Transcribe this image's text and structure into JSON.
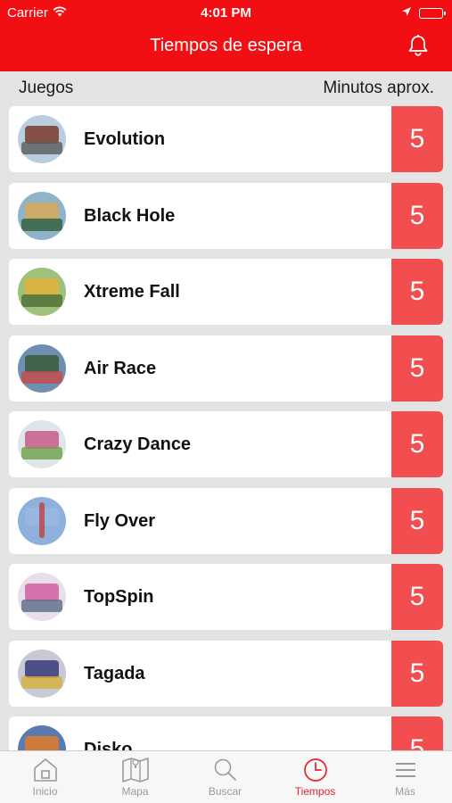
{
  "status": {
    "carrier": "Carrier",
    "time": "4:01 PM"
  },
  "header": {
    "title": "Tiempos de espera"
  },
  "columns": {
    "left": "Juegos",
    "right": "Minutos aprox."
  },
  "rides": [
    {
      "name": "Evolution",
      "wait": "5"
    },
    {
      "name": "Black Hole",
      "wait": "5"
    },
    {
      "name": "Xtreme Fall",
      "wait": "5"
    },
    {
      "name": "Air Race",
      "wait": "5"
    },
    {
      "name": "Crazy Dance",
      "wait": "5"
    },
    {
      "name": "Fly Over",
      "wait": "5"
    },
    {
      "name": "TopSpin",
      "wait": "5"
    },
    {
      "name": "Tagada",
      "wait": "5"
    },
    {
      "name": "Disko",
      "wait": "5"
    }
  ],
  "tabs": [
    {
      "label": "Inicio",
      "icon": "home-icon"
    },
    {
      "label": "Mapa",
      "icon": "map-icon"
    },
    {
      "label": "Buscar",
      "icon": "search-icon"
    },
    {
      "label": "Tiempos",
      "icon": "clock-icon"
    },
    {
      "label": "Más",
      "icon": "menu-icon"
    }
  ],
  "colors": {
    "header": "#f10f13",
    "wait_cell": "#f24d4f",
    "active_tab": "#e8212a"
  }
}
